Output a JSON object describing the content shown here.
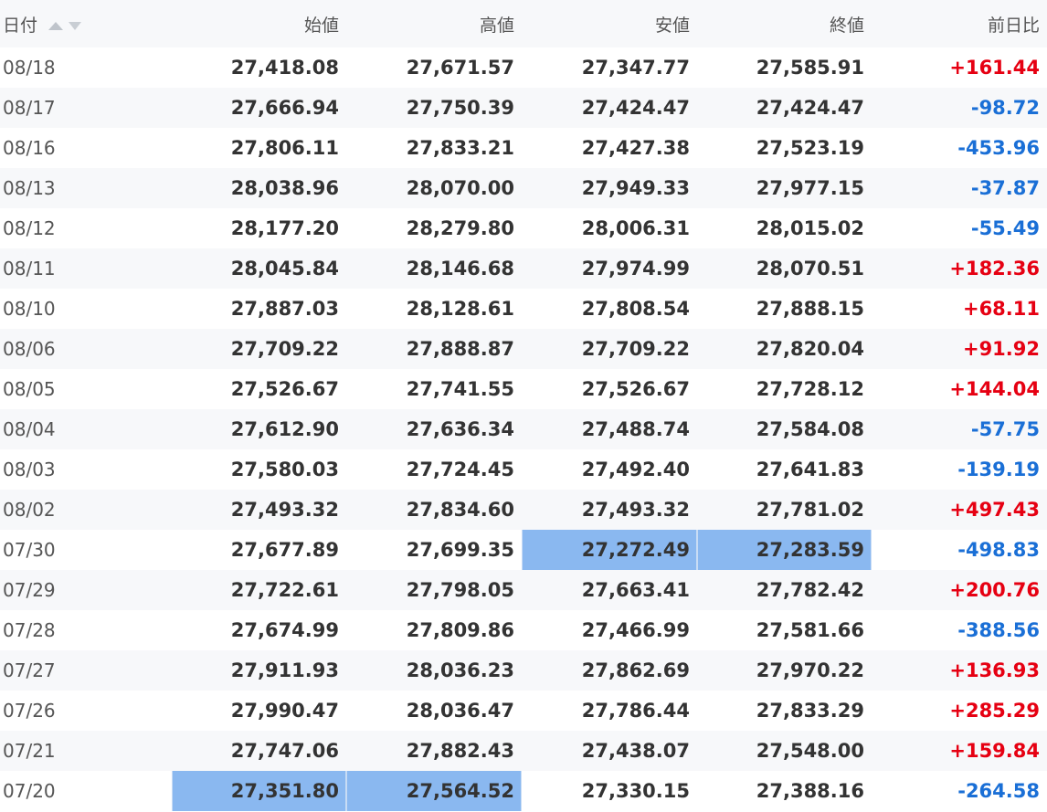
{
  "header": {
    "date": "日付",
    "open": "始値",
    "high": "高値",
    "low": "安値",
    "close": "終値",
    "change": "前日比",
    "sort_icons": [
      "sort-asc-icon",
      "sort-desc-icon"
    ]
  },
  "colors": {
    "positive": "#e60012",
    "negative": "#1a6fd6",
    "highlight": "#8ab8f0",
    "stripe": "#f7f8fa"
  },
  "rows": [
    {
      "date": "08/18",
      "open": "27,418.08",
      "high": "27,671.57",
      "low": "27,347.77",
      "close": "27,585.91",
      "change": "+161.44"
    },
    {
      "date": "08/17",
      "open": "27,666.94",
      "high": "27,750.39",
      "low": "27,424.47",
      "close": "27,424.47",
      "change": "-98.72"
    },
    {
      "date": "08/16",
      "open": "27,806.11",
      "high": "27,833.21",
      "low": "27,427.38",
      "close": "27,523.19",
      "change": "-453.96"
    },
    {
      "date": "08/13",
      "open": "28,038.96",
      "high": "28,070.00",
      "low": "27,949.33",
      "close": "27,977.15",
      "change": "-37.87"
    },
    {
      "date": "08/12",
      "open": "28,177.20",
      "high": "28,279.80",
      "low": "28,006.31",
      "close": "28,015.02",
      "change": "-55.49"
    },
    {
      "date": "08/11",
      "open": "28,045.84",
      "high": "28,146.68",
      "low": "27,974.99",
      "close": "28,070.51",
      "change": "+182.36"
    },
    {
      "date": "08/10",
      "open": "27,887.03",
      "high": "28,128.61",
      "low": "27,808.54",
      "close": "27,888.15",
      "change": "+68.11"
    },
    {
      "date": "08/06",
      "open": "27,709.22",
      "high": "27,888.87",
      "low": "27,709.22",
      "close": "27,820.04",
      "change": "+91.92"
    },
    {
      "date": "08/05",
      "open": "27,526.67",
      "high": "27,741.55",
      "low": "27,526.67",
      "close": "27,728.12",
      "change": "+144.04"
    },
    {
      "date": "08/04",
      "open": "27,612.90",
      "high": "27,636.34",
      "low": "27,488.74",
      "close": "27,584.08",
      "change": "-57.75"
    },
    {
      "date": "08/03",
      "open": "27,580.03",
      "high": "27,724.45",
      "low": "27,492.40",
      "close": "27,641.83",
      "change": "-139.19"
    },
    {
      "date": "08/02",
      "open": "27,493.32",
      "high": "27,834.60",
      "low": "27,493.32",
      "close": "27,781.02",
      "change": "+497.43"
    },
    {
      "date": "07/30",
      "open": "27,677.89",
      "high": "27,699.35",
      "low": "27,272.49",
      "close": "27,283.59",
      "change": "-498.83",
      "highlight": [
        "low",
        "close"
      ]
    },
    {
      "date": "07/29",
      "open": "27,722.61",
      "high": "27,798.05",
      "low": "27,663.41",
      "close": "27,782.42",
      "change": "+200.76"
    },
    {
      "date": "07/28",
      "open": "27,674.99",
      "high": "27,809.86",
      "low": "27,466.99",
      "close": "27,581.66",
      "change": "-388.56"
    },
    {
      "date": "07/27",
      "open": "27,911.93",
      "high": "28,036.23",
      "low": "27,862.69",
      "close": "27,970.22",
      "change": "+136.93"
    },
    {
      "date": "07/26",
      "open": "27,990.47",
      "high": "28,036.47",
      "low": "27,786.44",
      "close": "27,833.29",
      "change": "+285.29"
    },
    {
      "date": "07/21",
      "open": "27,747.06",
      "high": "27,882.43",
      "low": "27,438.07",
      "close": "27,548.00",
      "change": "+159.84"
    },
    {
      "date": "07/20",
      "open": "27,351.80",
      "high": "27,564.52",
      "low": "27,330.15",
      "close": "27,388.16",
      "change": "-264.58",
      "highlight": [
        "open",
        "high"
      ]
    }
  ]
}
